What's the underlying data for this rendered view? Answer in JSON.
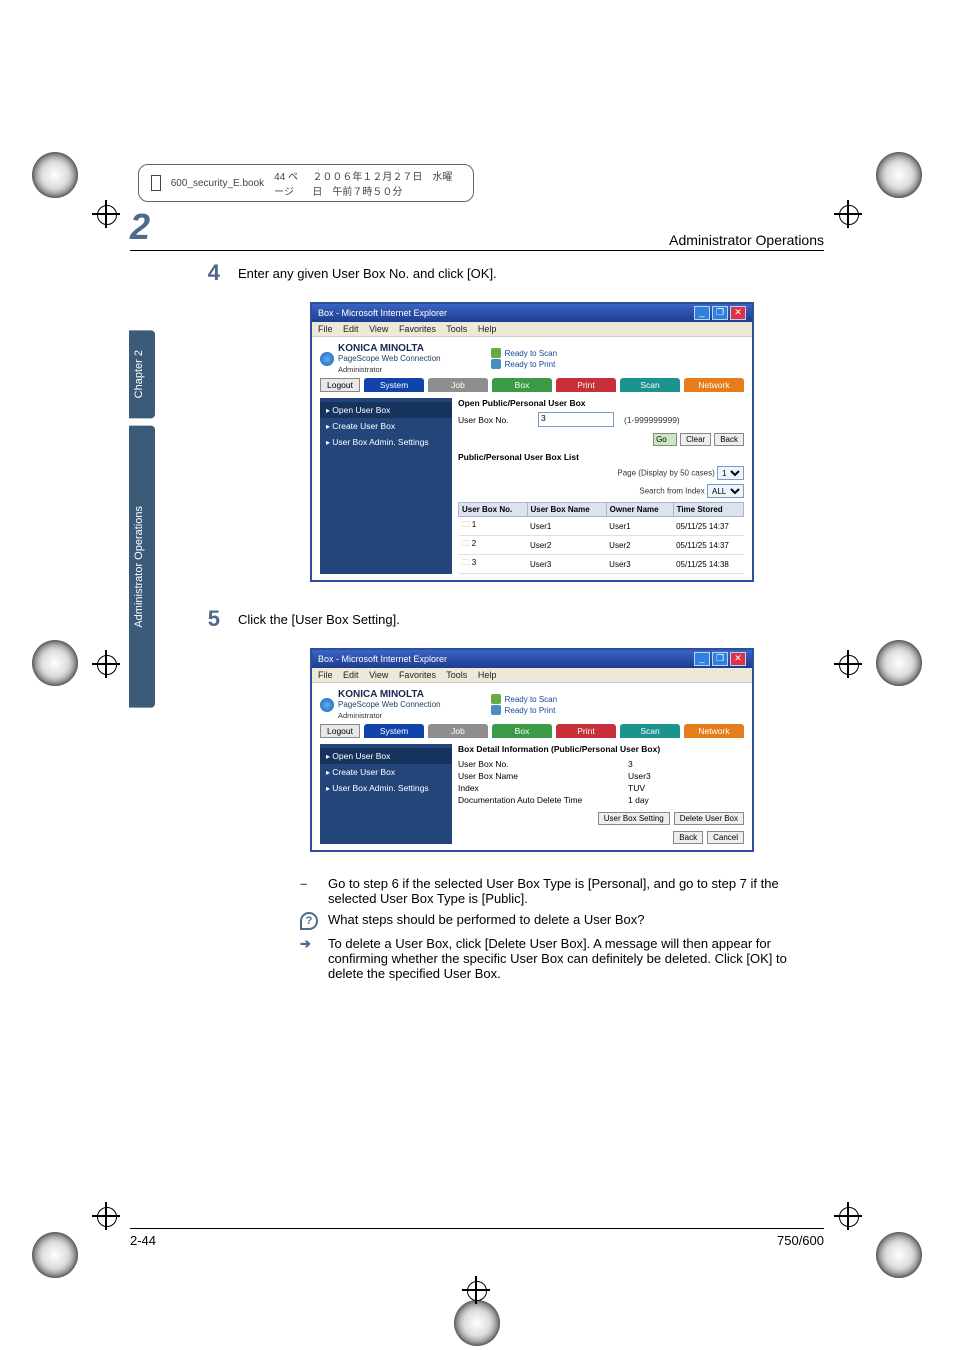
{
  "running_head": {
    "file": "600_security_E.book",
    "pageinfo": "44 ページ",
    "date": "２００６年１２月２７日　水曜日　午前７時５０分"
  },
  "header": {
    "chapter_num": "2",
    "title": "Administrator Operations"
  },
  "sidebar": {
    "chapter": "Chapter 2",
    "section": "Administrator Operations"
  },
  "steps": {
    "s4": {
      "num": "4",
      "text": "Enter any given User Box No. and click [OK]."
    },
    "s5": {
      "num": "5",
      "text": "Click the [User Box Setting]."
    }
  },
  "ie_common": {
    "window_title": "Box - Microsoft Internet Explorer",
    "min": "_",
    "max": "❐",
    "close": "✕",
    "menu": {
      "file": "File",
      "edit": "Edit",
      "view": "View",
      "fav": "Favorites",
      "tools": "Tools",
      "help": "Help"
    },
    "brand": "KONICA MINOLTA",
    "subbrand": "PageScope Web Connection",
    "status_scan": "Ready to Scan",
    "status_print": "Ready to Print",
    "admin": "Administrator",
    "logout": "Logout",
    "tabs": {
      "system": "System",
      "job": "Job",
      "box": "Box",
      "print": "Print",
      "scan": "Scan",
      "network": "Network"
    },
    "side_open": "Open User Box",
    "side_create": "Create User Box",
    "side_admin": "User Box Admin. Settings"
  },
  "shot1": {
    "heading": "Open Public/Personal User Box",
    "field_label": "User Box No.",
    "input_value": "3",
    "range": "(1-999999999)",
    "go": "Go",
    "clear": "Clear",
    "back": "Back",
    "list_heading": "Public/Personal User Box List",
    "page_label": "Page (Display by 50 cases)",
    "page_sel": "1",
    "index_label": "Search from Index",
    "index_sel": "ALL",
    "table": {
      "h1": "User Box No.",
      "h2": "User Box Name",
      "h3": "Owner Name",
      "h4": "Time Stored",
      "rows": [
        {
          "no": "1",
          "name": "User1",
          "owner": "User1",
          "time": "05/11/25 14:37"
        },
        {
          "no": "2",
          "name": "User2",
          "owner": "User2",
          "time": "05/11/25 14:37"
        },
        {
          "no": "3",
          "name": "User3",
          "owner": "User3",
          "time": "05/11/25 14:38"
        }
      ]
    }
  },
  "shot2": {
    "heading": "Box Detail Information (Public/Personal User Box)",
    "rows": {
      "no_k": "User Box No.",
      "no_v": "3",
      "name_k": "User Box Name",
      "name_v": "User3",
      "idx_k": "Index",
      "idx_v": "TUV",
      "auto_k": "Documentation Auto Delete Time",
      "auto_v": "1 day"
    },
    "btn_setting": "User Box Setting",
    "btn_delete": "Delete User Box",
    "btn_back": "Back",
    "btn_cancel": "Cancel"
  },
  "bullets": {
    "b1": "Go to step 6 if the selected User Box Type is [Personal], and go to step 7 if the selected User Box Type is [Public].",
    "q": "What steps should be performed to delete a User Box?",
    "a": "To delete a User Box, click [Delete User Box]. A message will then appear for confirming whether the specific User Box can definitely be deleted. Click [OK] to delete the specified User Box."
  },
  "footer": {
    "left": "2-44",
    "right": "750/600"
  }
}
